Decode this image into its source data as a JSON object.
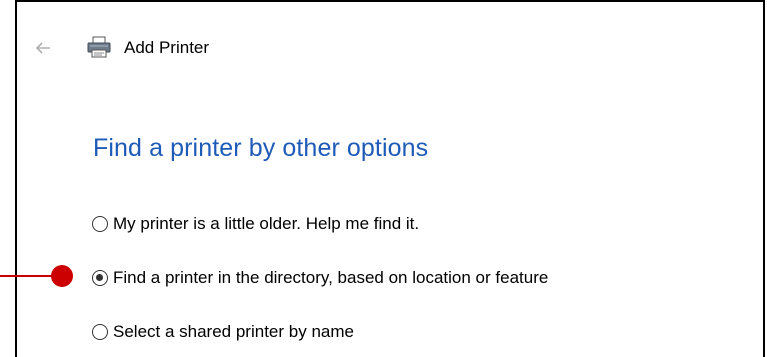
{
  "window": {
    "title": "Add Printer",
    "back_icon": "back-arrow-icon",
    "app_icon": "printer-icon"
  },
  "main": {
    "heading": "Find a printer by other options",
    "options": [
      {
        "label": "My printer is a little older. Help me find it.",
        "selected": false
      },
      {
        "label": "Find a printer in the directory, based on location or feature",
        "selected": true
      },
      {
        "label": "Select a shared printer by name",
        "selected": false
      }
    ]
  },
  "annotation": {
    "marker_color": "#cc0000"
  },
  "colors": {
    "heading": "#1e5bb8",
    "text": "#000000"
  }
}
